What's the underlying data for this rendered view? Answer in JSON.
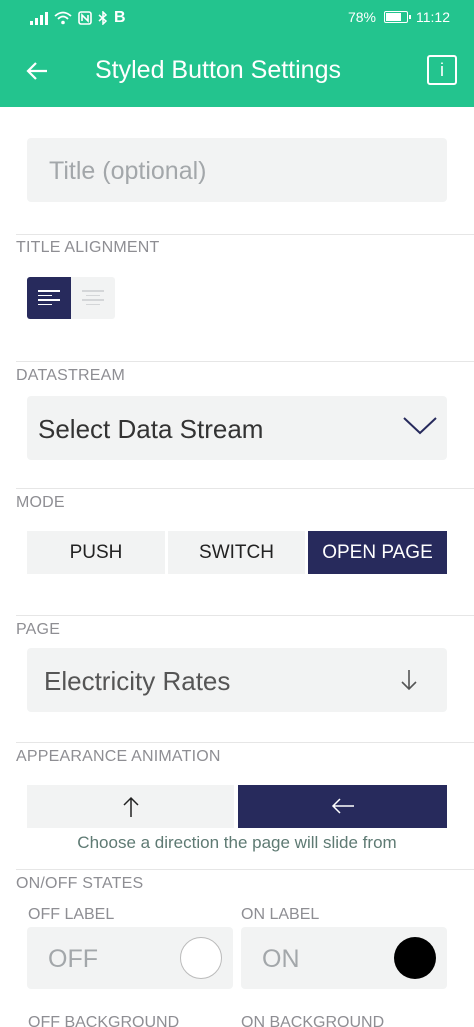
{
  "status_bar": {
    "right_battery": "78%",
    "time": "11:12",
    "battery_fraction": 0.78,
    "icons": [
      "signal-icon",
      "wifi-icon",
      "nfc-icon",
      "bluetooth-icon",
      "b-app-icon"
    ]
  },
  "header": {
    "title": "Styled Button Settings",
    "info_label": "i",
    "background_color": "#23c48e"
  },
  "title_field": {
    "placeholder": "Title (optional)"
  },
  "title_alignment": {
    "label": "TITLE ALIGNMENT",
    "options": [
      "left",
      "center"
    ],
    "selected": "left"
  },
  "datastream": {
    "label": "DATASTREAM",
    "value": "Select Data Stream"
  },
  "mode": {
    "label": "MODE",
    "options": [
      "PUSH",
      "SWITCH",
      "OPEN PAGE"
    ],
    "selected": "OPEN PAGE"
  },
  "page": {
    "label": "PAGE",
    "value": "Electricity Rates"
  },
  "appearance_animation": {
    "label": "APPEARANCE ANIMATION",
    "options": [
      "up-arrow",
      "left-arrow"
    ],
    "selected": "left-arrow",
    "hint": "Choose a direction the page will slide from"
  },
  "on_off_states": {
    "label": "ON/OFF STATES",
    "off_label_title": "OFF LABEL",
    "on_label_title": "ON LABEL",
    "off_value": "OFF",
    "on_value": "ON",
    "off_color": "#ffffff",
    "on_color": "#000000",
    "off_background_title": "OFF BACKGROUND",
    "on_background_title": "ON BACKGROUND"
  },
  "accent_color": "#272a5c"
}
